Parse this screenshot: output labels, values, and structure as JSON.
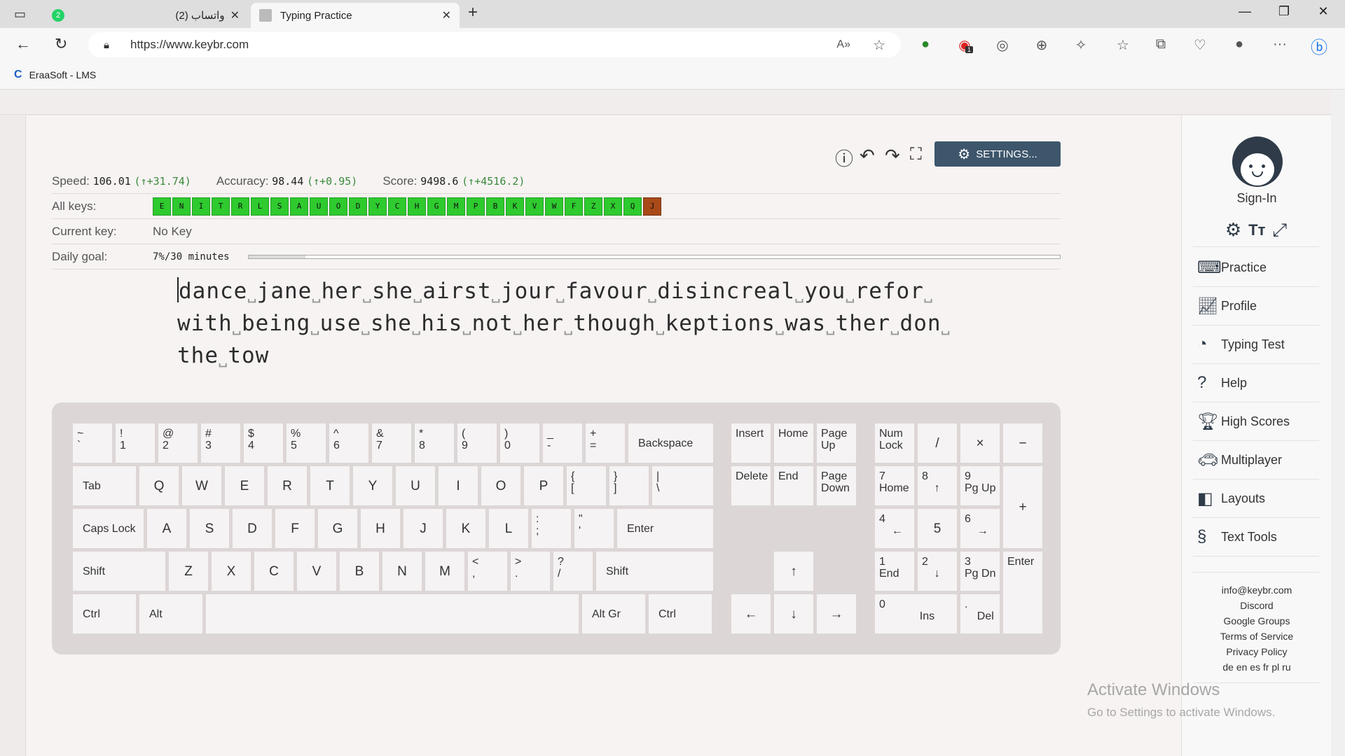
{
  "browser": {
    "tabs": [
      {
        "title": "(2) واتساب",
        "badge": "2",
        "active": false
      },
      {
        "title": "Typing Practice",
        "active": true
      }
    ],
    "url": "https://www.keybr.com",
    "favorites": [
      {
        "label": "EraaSoft - LMS"
      }
    ],
    "extension_badge": "1"
  },
  "stats": {
    "speed_label": "Speed:",
    "speed_value": "106.01",
    "speed_delta": "(↑+31.74)",
    "accuracy_label": "Accuracy:",
    "accuracy_value": "98.44",
    "accuracy_delta": "(↑+0.95)",
    "score_label": "Score:",
    "score_value": "9498.6",
    "score_delta": "(↑+4516.2)",
    "all_keys_label": "All keys:",
    "keys": [
      "E",
      "N",
      "I",
      "T",
      "R",
      "L",
      "S",
      "A",
      "U",
      "O",
      "D",
      "Y",
      "C",
      "H",
      "G",
      "M",
      "P",
      "B",
      "K",
      "V",
      "W",
      "F",
      "Z",
      "X",
      "Q",
      "J"
    ],
    "key_colors": {
      "done": "#2eca2e",
      "current": "#a84a18"
    },
    "current_key_label": "Current key:",
    "current_key_value": "No Key",
    "daily_goal_label": "Daily goal:",
    "daily_goal_value": "7%/30 minutes",
    "daily_goal_progress": 0.07
  },
  "toolbar": {
    "settings_label": "SETTINGS..."
  },
  "practice_text": {
    "lines": [
      [
        "dance",
        "jane",
        "her",
        "she",
        "airst",
        "jour",
        "favour",
        "disincreal",
        "you",
        "refor"
      ],
      [
        "with",
        "being",
        "use",
        "she",
        "his",
        "not",
        "her",
        "though",
        "keptions",
        "was",
        "ther",
        "don"
      ],
      [
        "the",
        "tow"
      ]
    ]
  },
  "keyboard": {
    "row1": [
      [
        "~\n`"
      ],
      [
        "!\n1"
      ],
      [
        "@\n2"
      ],
      [
        "#\n3"
      ],
      [
        "$\n4"
      ],
      [
        "%\n5"
      ],
      [
        "^\n6"
      ],
      [
        "&\n7"
      ],
      [
        "*\n8"
      ],
      [
        "(\n9"
      ],
      [
        ")\n0"
      ],
      [
        "_\n-"
      ],
      [
        "+\n="
      ],
      [
        "Backspace"
      ]
    ],
    "row2": [
      "Tab",
      "Q",
      "W",
      "E",
      "R",
      "T",
      "Y",
      "U",
      "I",
      "O",
      "P",
      "{\n[",
      "}\n]",
      "|\n\\"
    ],
    "row3": [
      "Caps Lock",
      "A",
      "S",
      "D",
      "F",
      "G",
      "H",
      "J",
      "K",
      "L",
      ":\n;",
      "\"\n'",
      "Enter"
    ],
    "row4": [
      "Shift",
      "Z",
      "X",
      "C",
      "V",
      "B",
      "N",
      "M",
      "<\n,",
      ">\n.",
      "?\n/",
      "Shift"
    ],
    "row5": [
      "Ctrl",
      "Alt",
      "",
      "Alt Gr",
      "Ctrl"
    ],
    "nav": [
      "Insert",
      "Home",
      "Page\nUp",
      "Delete",
      "End",
      "Page\nDown"
    ],
    "arrows": [
      "↑",
      "←",
      "↓",
      "→"
    ],
    "numpad": [
      "Num\nLock",
      "/",
      "×",
      "−",
      "7\nHome",
      "8\n    ↑",
      "9\nPg Up",
      "+",
      "4\n    ←",
      "5",
      "6\n    →",
      "1\nEnd",
      "2\n    ↓",
      "3\nPg Dn",
      "Enter",
      "0\n             Ins",
      ".\n    Del"
    ]
  },
  "sidebar": {
    "signin_label": "Sign-In",
    "menu": [
      {
        "label": "Practice",
        "icon": "keyboard-icon"
      },
      {
        "label": "Profile",
        "icon": "chart-icon"
      },
      {
        "label": "Typing Test",
        "icon": "speedometer-icon"
      },
      {
        "label": "Help",
        "icon": "help-icon"
      },
      {
        "label": "High Scores",
        "icon": "trophy-icon"
      },
      {
        "label": "Multiplayer",
        "icon": "car-icon"
      },
      {
        "label": "Layouts",
        "icon": "layouts-icon"
      },
      {
        "label": "Text Tools",
        "icon": "section-icon"
      }
    ],
    "footer": [
      "info@keybr.com",
      "Discord",
      "Google Groups",
      "Terms of Service",
      "Privacy Policy",
      "de en es fr pl ru"
    ]
  },
  "watermark": {
    "line1": "Activate Windows",
    "line2": "Go to Settings to activate Windows."
  }
}
